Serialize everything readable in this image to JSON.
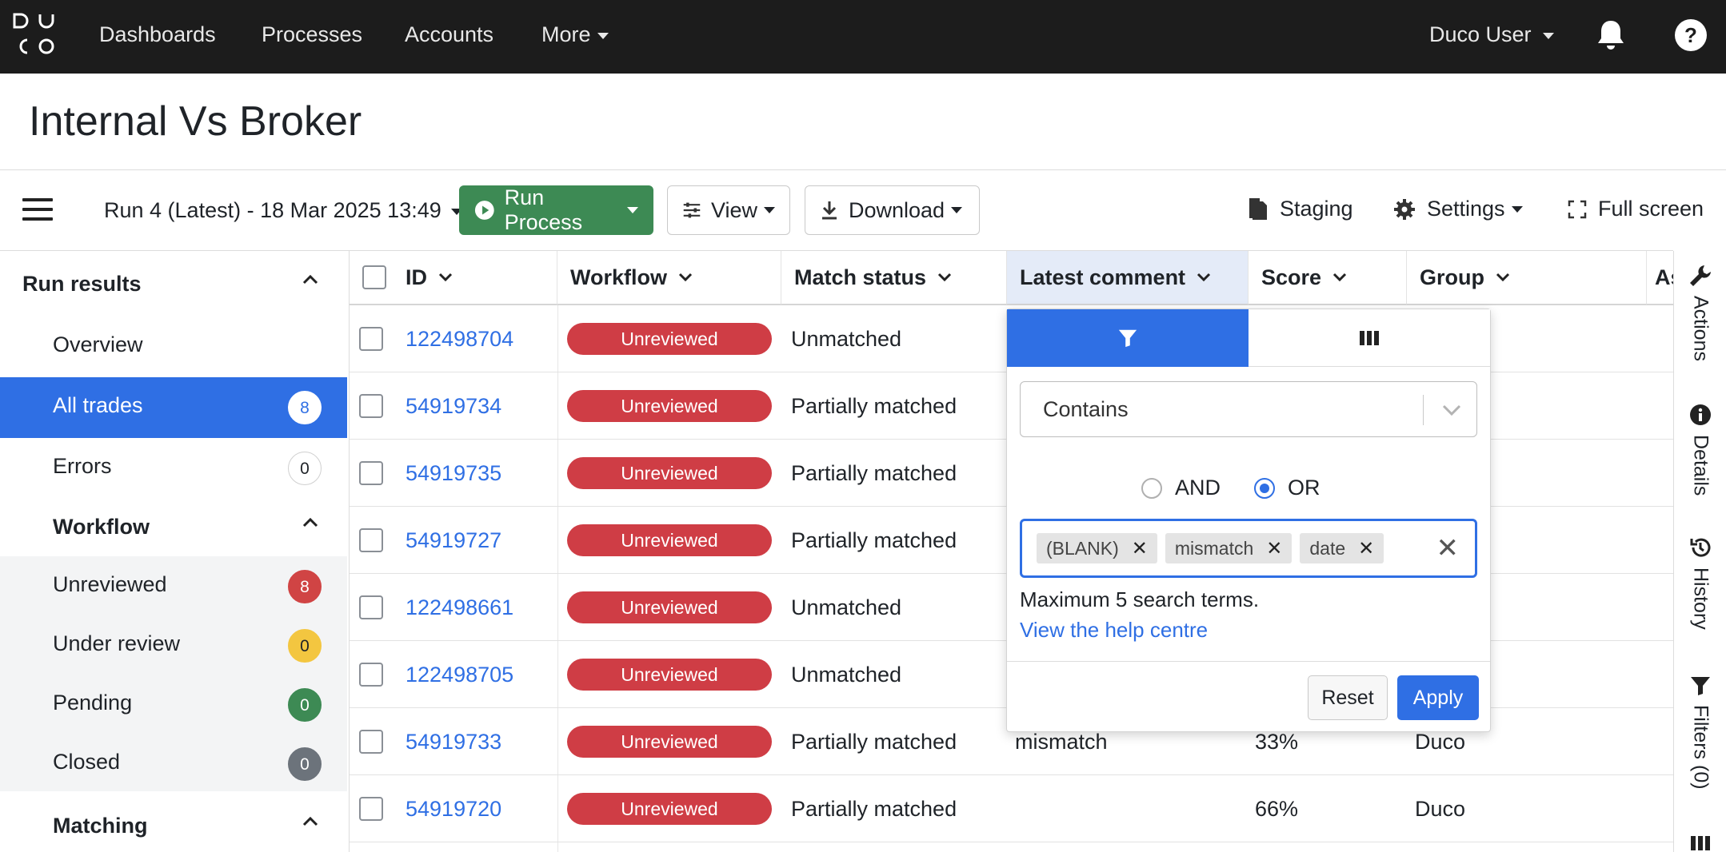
{
  "nav": {
    "items": [
      "Dashboards",
      "Processes",
      "Accounts",
      "More"
    ],
    "user": "Duco User"
  },
  "page": {
    "title": "Internal Vs Broker"
  },
  "toolbar": {
    "run_select": "Run 4 (Latest) - 18 Mar 2025 13:49",
    "run_process": "Run Process",
    "view": "View",
    "download": "Download",
    "staging": "Staging",
    "settings": "Settings",
    "fullscreen": "Full screen"
  },
  "sidebar": {
    "run_results": {
      "heading": "Run results",
      "items": [
        {
          "label": "Overview",
          "count": ""
        },
        {
          "label": "All trades",
          "count": "8"
        },
        {
          "label": "Errors",
          "count": "0"
        }
      ]
    },
    "workflow": {
      "heading": "Workflow",
      "items": [
        {
          "label": "Unreviewed",
          "count": "8"
        },
        {
          "label": "Under review",
          "count": "0"
        },
        {
          "label": "Pending",
          "count": "0"
        },
        {
          "label": "Closed",
          "count": "0"
        }
      ]
    },
    "matching": {
      "heading": "Matching"
    }
  },
  "table": {
    "columns": [
      "ID",
      "Workflow",
      "Match status",
      "Latest comment",
      "Score",
      "Group",
      "As"
    ],
    "rows": [
      {
        "id": "122498704",
        "workflow": "Unreviewed",
        "match_status": "Unmatched",
        "comment": "",
        "score": "",
        "group": ""
      },
      {
        "id": "54919734",
        "workflow": "Unreviewed",
        "match_status": "Partially matched",
        "comment": "",
        "score": "",
        "group": ""
      },
      {
        "id": "54919735",
        "workflow": "Unreviewed",
        "match_status": "Partially matched",
        "comment": "",
        "score": "",
        "group": ""
      },
      {
        "id": "54919727",
        "workflow": "Unreviewed",
        "match_status": "Partially matched",
        "comment": "",
        "score": "",
        "group": ""
      },
      {
        "id": "122498661",
        "workflow": "Unreviewed",
        "match_status": "Unmatched",
        "comment": "",
        "score": "",
        "group": ""
      },
      {
        "id": "122498705",
        "workflow": "Unreviewed",
        "match_status": "Unmatched",
        "comment": "",
        "score": "",
        "group": ""
      },
      {
        "id": "54919733",
        "workflow": "Unreviewed",
        "match_status": "Partially matched",
        "comment": "mismatch",
        "score": "33%",
        "group": "Duco"
      },
      {
        "id": "54919720",
        "workflow": "Unreviewed",
        "match_status": "Partially matched",
        "comment": "",
        "score": "66%",
        "group": "Duco"
      }
    ]
  },
  "filter_popup": {
    "operator": "Contains",
    "and_label": "AND",
    "or_label": "OR",
    "selected_join": "OR",
    "chips": [
      "(BLANK)",
      "mismatch",
      "date"
    ],
    "hint": "Maximum 5 search terms.",
    "help_link": "View the help centre",
    "reset": "Reset",
    "apply": "Apply"
  },
  "rail": [
    "Actions",
    "Details",
    "History",
    "Filters (0)"
  ],
  "colors": {
    "accent": "#2f6fe4",
    "run_process": "#3d8a54",
    "unreviewed_pill": "#cf3d45",
    "topbar": "#1c1c1c"
  }
}
